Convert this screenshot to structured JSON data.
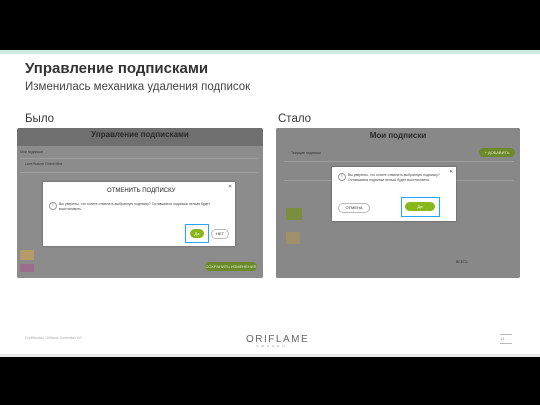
{
  "slide": {
    "title": "Управление подписками",
    "subtitle": "Изменилась механика удаления подписок",
    "before_label": "Было",
    "after_label": "Стало",
    "footer_text": "Confidential. Oriflame Cosmetics AG",
    "page_number": "14"
  },
  "logo": {
    "main": "ORIFLAME",
    "sub": "SWEDEN"
  },
  "before": {
    "header": "Управление подписками",
    "section": "Мои подписки",
    "product_name": "Love Nature Orient Mist",
    "dialog_title": "ОТМЕНИТЬ ПОДПИСКУ",
    "dialog_text": "Вы уверены, что хотите отменить выбранную подписку? Оставшиеся подписки нельзя будет восстановить.",
    "ok_label": "Да",
    "cancel_label": "НЕТ",
    "save_label": "СОХРАНИТЬ ИЗМЕНЕНИЯ"
  },
  "after": {
    "header": "Мои подписки",
    "subheader": "Текущие подписки",
    "add_label": "+ ДОБАВИТЬ",
    "dialog_text": "Вы уверены, что хотите отменить выбранную подписку? Оставшиеся подписки нельзя будет восстановить.",
    "cancel_label": "ОТМЕНА",
    "ok_label": "Да",
    "total_label": "ВСЕГО"
  },
  "colors": {
    "accent_green": "#89b81a",
    "highlight_blue": "#27a6ff"
  }
}
